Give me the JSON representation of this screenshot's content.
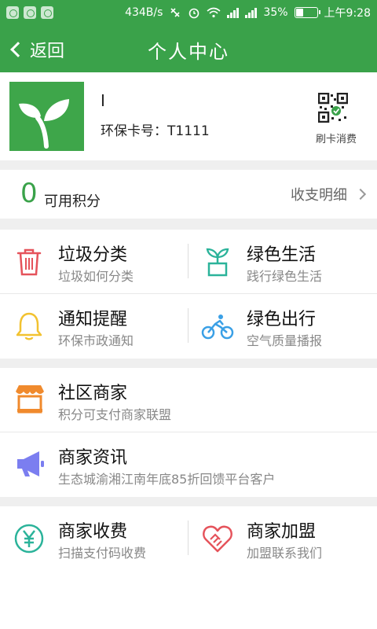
{
  "status_bar": {
    "speed": "434B/s",
    "battery": "35%",
    "time": "上午9:28",
    "battery_level": 0.35
  },
  "header": {
    "back_label": "返回",
    "title": "个人中心"
  },
  "profile": {
    "name": "I",
    "card_label": "环保卡号：T1111",
    "qr_label": "刷卡消费"
  },
  "points": {
    "value": "0",
    "label": "可用积分",
    "detail_label": "收支明细"
  },
  "grid1": [
    {
      "title": "垃圾分类",
      "subtitle": "垃圾如何分类",
      "icon": "trash-icon"
    },
    {
      "title": "绿色生活",
      "subtitle": "践行绿色生活",
      "icon": "plant-pot-icon"
    },
    {
      "title": "通知提醒",
      "subtitle": "环保市政通知",
      "icon": "bell-icon"
    },
    {
      "title": "绿色出行",
      "subtitle": "空气质量播报",
      "icon": "bicycle-icon"
    }
  ],
  "list": [
    {
      "title": "社区商家",
      "subtitle": "积分可支付商家联盟",
      "icon": "shop-icon"
    },
    {
      "title": "商家资讯",
      "subtitle": "生态城渝湘江南年底85折回馈平台客户",
      "icon": "megaphone-icon"
    }
  ],
  "grid2": [
    {
      "title": "商家收费",
      "subtitle": "扫描支付码收费",
      "icon": "yen-icon"
    },
    {
      "title": "商家加盟",
      "subtitle": "加盟联系我们",
      "icon": "heart-handshake-icon"
    }
  ],
  "colors": {
    "brand": "#3aa24a",
    "trash": "#e5535b",
    "plant": "#2bb39a",
    "bell": "#f2c230",
    "bike": "#3aa0e6",
    "shop": "#f08a2d",
    "megaphone": "#7b7ef0",
    "yen": "#2bb39a",
    "heart": "#e5535b"
  }
}
